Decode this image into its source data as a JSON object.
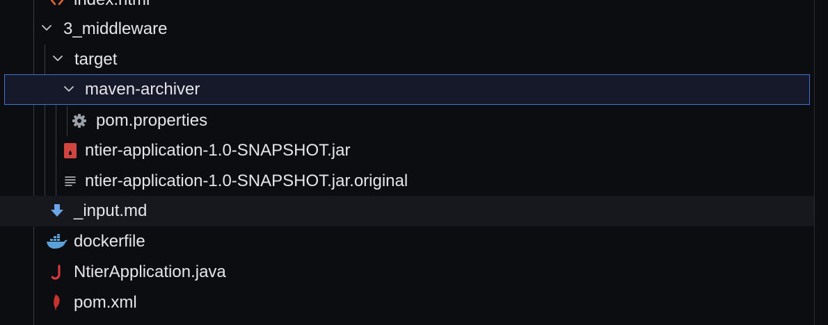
{
  "explorer": {
    "items": [
      {
        "label": "index.html",
        "type": "file",
        "icon": "html-file-icon"
      },
      {
        "label": "3_middleware",
        "type": "folder",
        "expanded": true
      },
      {
        "label": "target",
        "type": "folder",
        "expanded": true
      },
      {
        "label": "maven-archiver",
        "type": "folder",
        "expanded": true,
        "selected": true
      },
      {
        "label": "pom.properties",
        "type": "file",
        "icon": "gear-icon"
      },
      {
        "label": "ntier-application-1.0-SNAPSHOT.jar",
        "type": "file",
        "icon": "jar-file-icon"
      },
      {
        "label": "ntier-application-1.0-SNAPSHOT.jar.original",
        "type": "file",
        "icon": "text-lines-icon"
      },
      {
        "label": "_input.md",
        "type": "file",
        "icon": "markdown-arrow-icon"
      },
      {
        "label": "dockerfile",
        "type": "file",
        "icon": "docker-whale-icon"
      },
      {
        "label": "NtierApplication.java",
        "type": "file",
        "icon": "java-file-icon"
      },
      {
        "label": "pom.xml",
        "type": "file",
        "icon": "maven-feather-icon"
      }
    ]
  },
  "colors": {
    "background": "#0c0d11",
    "selection_border": "#3f73d4",
    "selection_background": "#15192a",
    "hover_background": "#16181d",
    "text": "#e6e6ea",
    "icon_gray": "#9aa0a8",
    "jar_red": "#d0453f",
    "markdown_blue": "#6aa6e8",
    "docker_blue": "#5aa2d8",
    "java_red": "#d7393c",
    "maven_red": "#c8322f"
  }
}
